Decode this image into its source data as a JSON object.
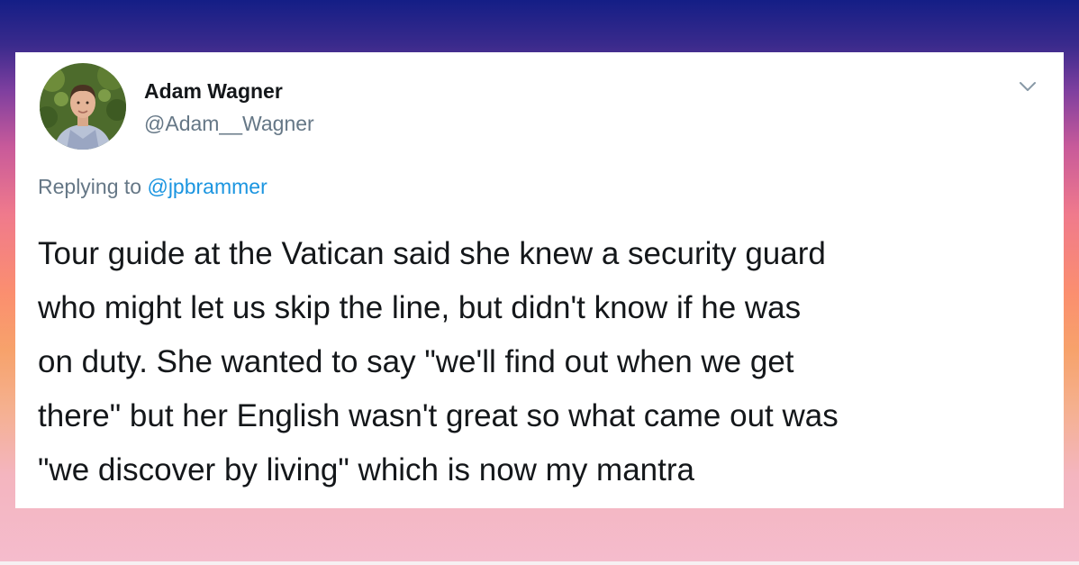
{
  "tweet": {
    "author": {
      "name": "Adam Wagner",
      "handle": "@Adam__Wagner",
      "avatar_icon": "profile-photo"
    },
    "menu_icon": "chevron-down-icon",
    "reply": {
      "prefix": "Replying to",
      "handle": "@jpbrammer"
    },
    "text_lines": [
      "Tour guide at the Vatican said she knew a security guard",
      "who might let us skip the line, but didn't know if he was",
      "on duty. She wanted to say \"we'll find out when we get",
      "there\" but her English wasn't great so what came out was",
      "\"we discover by living\" which is now my mantra"
    ]
  },
  "colors": {
    "gradient_top": "#141e86",
    "gradient_middle": "#fb8f6f",
    "gradient_bottom": "#f5bccd",
    "name_text": "#14171a",
    "secondary_text": "#657786",
    "link": "#1b95e0",
    "card_background": "#ffffff"
  }
}
